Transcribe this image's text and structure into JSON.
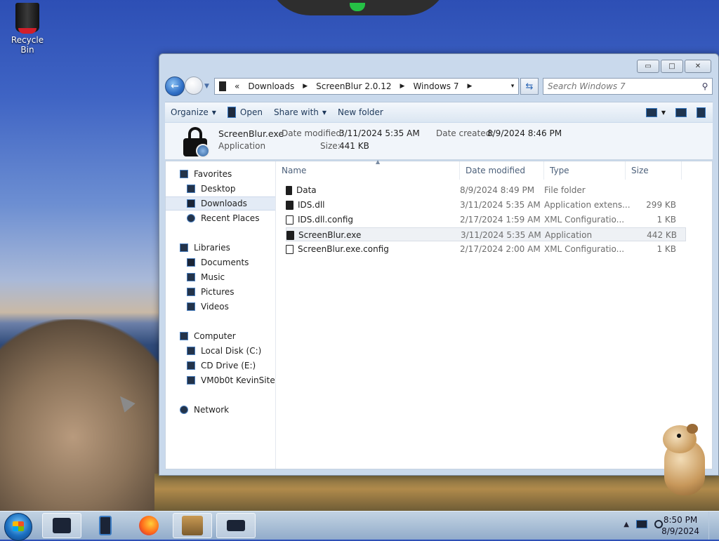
{
  "desktop": {
    "recycle_bin_label": "Recycle Bin"
  },
  "window": {
    "controls": {
      "minimize": "▭",
      "maximize": "□",
      "close": "✕"
    },
    "address": {
      "overflow": "«",
      "segments": [
        "Downloads",
        "ScreenBlur 2.0.12",
        "Windows 7"
      ],
      "arrow": "▶",
      "dropdown": "▾"
    },
    "refresh_icon": "⇆",
    "search": {
      "placeholder": "Search Windows 7",
      "icon": "⚲"
    },
    "toolbar": {
      "organize": "Organize",
      "open": "Open",
      "share_with": "Share with",
      "new_folder": "New folder",
      "caret": "▼"
    },
    "details": {
      "name": "ScreenBlur.exe",
      "type": "Application",
      "date_modified_label": "Date modified:",
      "date_modified": "3/11/2024 5:35 AM",
      "date_created_label": "Date created:",
      "date_created": "8/9/2024 8:46 PM",
      "size_label": "Size:",
      "size": "441 KB"
    },
    "nav": {
      "favorites": "Favorites",
      "desktop": "Desktop",
      "downloads": "Downloads",
      "recent_places": "Recent Places",
      "libraries": "Libraries",
      "documents": "Documents",
      "music": "Music",
      "pictures": "Pictures",
      "videos": "Videos",
      "computer": "Computer",
      "local_disk": "Local Disk (C:)",
      "cd_drive": "CD Drive (E:)",
      "network_share": "VM0b0t KevinSite",
      "network": "Network"
    },
    "columns": {
      "name": "Name",
      "date_modified": "Date modified",
      "type": "Type",
      "size": "Size",
      "sort_caret": "▲"
    },
    "files": [
      {
        "name": "Data",
        "date": "8/9/2024 8:49 PM",
        "type": "File folder",
        "size": ""
      },
      {
        "name": "IDS.dll",
        "date": "3/11/2024 5:35 AM",
        "type": "Application extens...",
        "size": "299 KB"
      },
      {
        "name": "IDS.dll.config",
        "date": "2/17/2024 1:59 AM",
        "type": "XML Configuratio...",
        "size": "1 KB"
      },
      {
        "name": "ScreenBlur.exe",
        "date": "3/11/2024 5:35 AM",
        "type": "Application",
        "size": "442 KB"
      },
      {
        "name": "ScreenBlur.exe.config",
        "date": "2/17/2024 2:00 AM",
        "type": "XML Configuratio...",
        "size": "1 KB"
      }
    ]
  },
  "taskbar": {
    "tray_arrow": "▲",
    "time": "8:50 PM",
    "date": "8/9/2024"
  }
}
